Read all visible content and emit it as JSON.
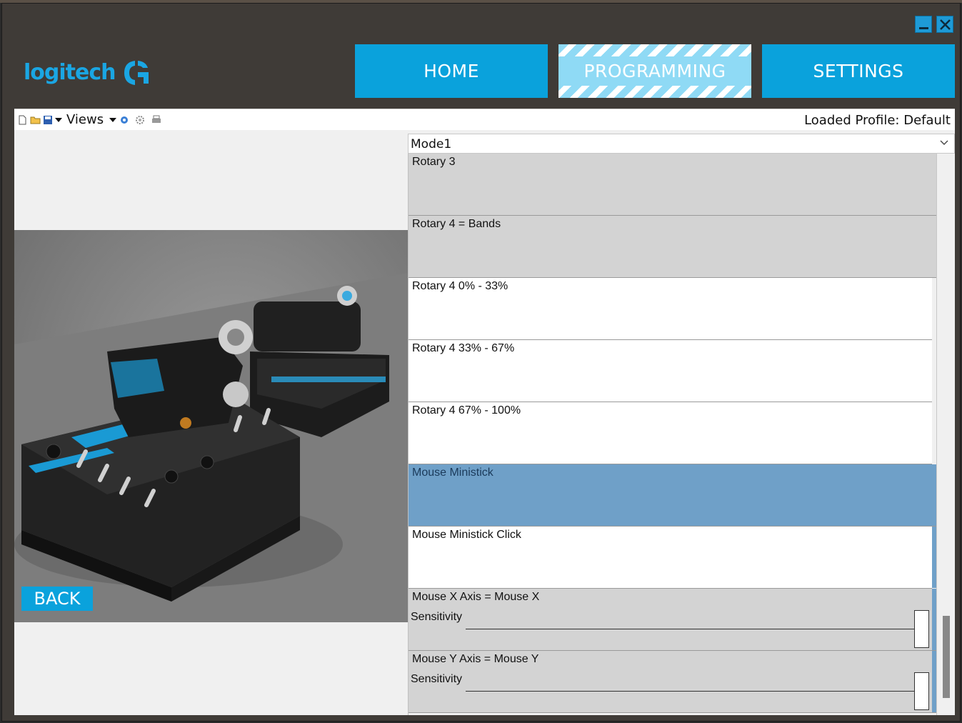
{
  "window": {
    "minimize_icon": "minimize-icon",
    "close_icon": "close-icon",
    "accent_color": "#0aa2dc"
  },
  "logo": {
    "text": "logitech",
    "mark_icon": "logitech-g-icon"
  },
  "nav": {
    "home": "HOME",
    "programming": "PROGRAMMING",
    "settings": "SETTINGS",
    "active": "programming"
  },
  "toolbar": {
    "icons": [
      "new-file-icon",
      "open-folder-icon",
      "save-icon",
      "network-icon",
      "gear-icon",
      "print-icon"
    ],
    "views_label": "Views",
    "loaded_profile": "Loaded Profile: Default"
  },
  "mode_select": {
    "value": "Mode1"
  },
  "assignments": [
    {
      "label": "Rotary 3",
      "style": "gray"
    },
    {
      "label": "Rotary 4 = Bands",
      "style": "gray"
    },
    {
      "label": "Rotary 4 0% - 33%",
      "style": "white"
    },
    {
      "label": "Rotary 4 33% - 67%",
      "style": "white"
    },
    {
      "label": "Rotary 4 67% - 100%",
      "style": "white"
    },
    {
      "label": "Mouse Ministick",
      "style": "selected"
    },
    {
      "label": "Mouse Ministick Click",
      "style": "white"
    },
    {
      "label": "Mouse X Axis = Mouse X",
      "style": "gray",
      "sensitivity_label": "Sensitivity"
    },
    {
      "label": "Mouse Y Axis = Mouse Y",
      "style": "gray",
      "sensitivity_label": "Sensitivity"
    }
  ],
  "device_image": {
    "description_icon": "throttle-quadrant-image"
  },
  "back_button": {
    "label": "BACK"
  }
}
